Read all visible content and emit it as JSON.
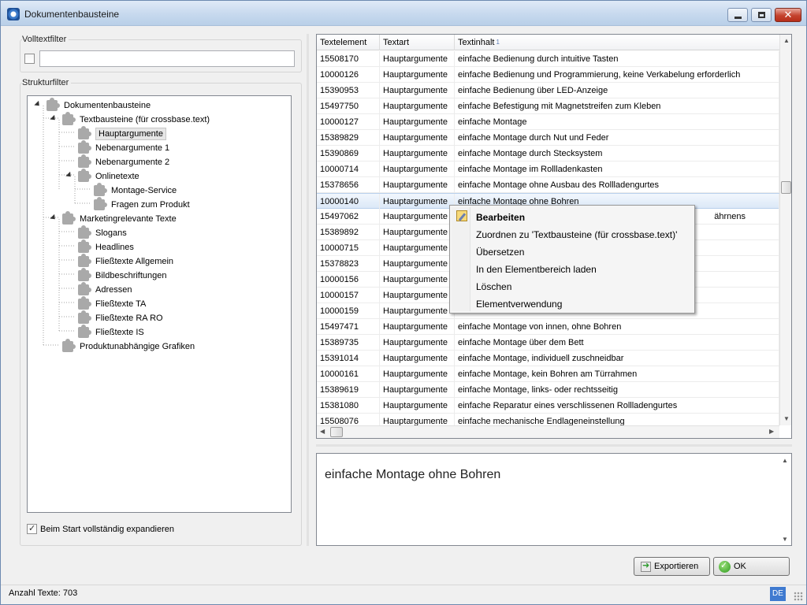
{
  "window": {
    "title": "Dokumentenbausteine"
  },
  "volltextfilter": {
    "label": "Volltextfilter",
    "value": ""
  },
  "strukturfilter": {
    "label": "Strukturfilter",
    "tree": [
      {
        "label": "Dokumentenbausteine",
        "level": 0,
        "expanded": true
      },
      {
        "label": "Textbausteine (für crossbase.text)",
        "level": 1,
        "expanded": true
      },
      {
        "label": "Hauptargumente",
        "level": 2,
        "selected": true
      },
      {
        "label": "Nebenargumente 1",
        "level": 2
      },
      {
        "label": "Nebenargumente 2",
        "level": 2
      },
      {
        "label": "Onlinetexte",
        "level": 2,
        "expanded": true
      },
      {
        "label": "Montage-Service",
        "level": 3
      },
      {
        "label": "Fragen zum Produkt",
        "level": 3
      },
      {
        "label": "Marketingrelevante Texte",
        "level": 1,
        "expanded": true
      },
      {
        "label": "Slogans",
        "level": 2
      },
      {
        "label": "Headlines",
        "level": 2
      },
      {
        "label": "Fließtexte Allgemein",
        "level": 2
      },
      {
        "label": "Bildbeschriftungen",
        "level": 2
      },
      {
        "label": "Adressen",
        "level": 2
      },
      {
        "label": "Fließtexte TA",
        "level": 2
      },
      {
        "label": "Fließtexte RA RO",
        "level": 2
      },
      {
        "label": "Fließtexte IS",
        "level": 2
      },
      {
        "label": "Produktunabhängige Grafiken",
        "level": 1
      }
    ]
  },
  "expand_on_start": {
    "label": "Beim Start vollständig expandieren",
    "checked": true
  },
  "table": {
    "columns": [
      "Textelement",
      "Textart",
      "Textinhalt"
    ],
    "sort_badge": "1",
    "rows": [
      [
        "15508170",
        "Hauptargumente",
        "einfache Bedienung durch intuitive Tasten"
      ],
      [
        "10000126",
        "Hauptargumente",
        "einfache Bedienung und Programmierung, keine Verkabelung erforderlich"
      ],
      [
        "15390953",
        "Hauptargumente",
        "einfache Bedienung über LED-Anzeige"
      ],
      [
        "15497750",
        "Hauptargumente",
        "einfache Befestigung mit Magnetstreifen zum Kleben"
      ],
      [
        "10000127",
        "Hauptargumente",
        "einfache Montage"
      ],
      [
        "15389829",
        "Hauptargumente",
        "einfache Montage durch Nut und Feder"
      ],
      [
        "15390869",
        "Hauptargumente",
        "einfache Montage durch Stecksystem"
      ],
      [
        "10000714",
        "Hauptargumente",
        "einfache Montage im Rollladenkasten"
      ],
      [
        "15378656",
        "Hauptargumente",
        "einfache Montage ohne Ausbau des Rollladengurtes"
      ],
      [
        "10000140",
        "Hauptargumente",
        "einfache Montage ohne Bohren"
      ],
      [
        "15497062",
        "Hauptargumente",
        "ährnens"
      ],
      [
        "15389892",
        "Hauptargumente",
        ""
      ],
      [
        "10000715",
        "Hauptargumente",
        ""
      ],
      [
        "15378823",
        "Hauptargumente",
        ""
      ],
      [
        "10000156",
        "Hauptargumente",
        ""
      ],
      [
        "10000157",
        "Hauptargumente",
        ""
      ],
      [
        "10000159",
        "Hauptargumente",
        ""
      ],
      [
        "15497471",
        "Hauptargumente",
        "einfache Montage von innen, ohne Bohren"
      ],
      [
        "15389735",
        "Hauptargumente",
        "einfache Montage über dem Bett"
      ],
      [
        "15391014",
        "Hauptargumente",
        "einfache Montage, individuell zuschneidbar"
      ],
      [
        "10000161",
        "Hauptargumente",
        "einfache Montage, kein Bohren am Türrahmen"
      ],
      [
        "15389619",
        "Hauptargumente",
        "einfache Montage, links- oder rechtsseitig"
      ],
      [
        "15381080",
        "Hauptargumente",
        "einfache Reparatur eines verschlissenen Rollladengurtes"
      ],
      [
        "15508076",
        "Hauptargumente",
        "einfache mechanische Endlageneinstellung"
      ]
    ],
    "selected_row": 9
  },
  "preview": {
    "text": "einfache Montage ohne Bohren"
  },
  "context_menu": {
    "items": [
      "Bearbeiten",
      "Zuordnen zu 'Textbausteine (für crossbase.text)'",
      "Übersetzen",
      "In den Elementbereich laden",
      "Löschen",
      "Elementverwendung"
    ]
  },
  "buttons": {
    "export": "Exportieren",
    "ok": "OK"
  },
  "status": {
    "count_text": "Anzahl Texte: 703",
    "language": "DE"
  }
}
